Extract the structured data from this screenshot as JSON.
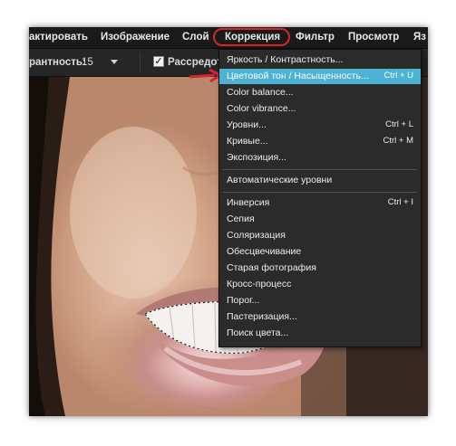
{
  "menubar": {
    "items": [
      "актировать",
      "Изображение",
      "Слой",
      "Коррекция",
      "Фильтр",
      "Просмотр",
      "Яз"
    ]
  },
  "toolbar": {
    "tolerance_label": "рантность:",
    "tolerance_value": "15",
    "spread_checkbox_label": "Рассредот"
  },
  "canvas": {
    "filename": "7813_106"
  },
  "dropdown": {
    "items": [
      {
        "label": "Яркость / Контрастность...",
        "shortcut": ""
      },
      {
        "label": "Цветовой тон / Насыщенность...",
        "shortcut": "Ctrl + U",
        "selected": true
      },
      {
        "label": "Color balance...",
        "shortcut": ""
      },
      {
        "label": "Color vibrance...",
        "shortcut": ""
      },
      {
        "label": "Уровни...",
        "shortcut": "Ctrl + L"
      },
      {
        "label": "Кривые...",
        "shortcut": "Ctrl + M"
      },
      {
        "label": "Экспозиция...",
        "shortcut": ""
      },
      {
        "label": "Автоматические уровни",
        "shortcut": ""
      },
      {
        "label": "Инверсия",
        "shortcut": "Ctrl + I"
      },
      {
        "label": "Сепия",
        "shortcut": ""
      },
      {
        "label": "Соляризация",
        "shortcut": ""
      },
      {
        "label": "Обесцвечивание",
        "shortcut": ""
      },
      {
        "label": "Старая фотография",
        "shortcut": ""
      },
      {
        "label": "Кросс-процесс",
        "shortcut": ""
      },
      {
        "label": "Порог...",
        "shortcut": ""
      },
      {
        "label": "Пастеризация...",
        "shortcut": ""
      },
      {
        "label": "Поиск цвета...",
        "shortcut": ""
      }
    ]
  },
  "colors": {
    "selection": "#4cb3d6",
    "annotation": "#d7262b"
  }
}
